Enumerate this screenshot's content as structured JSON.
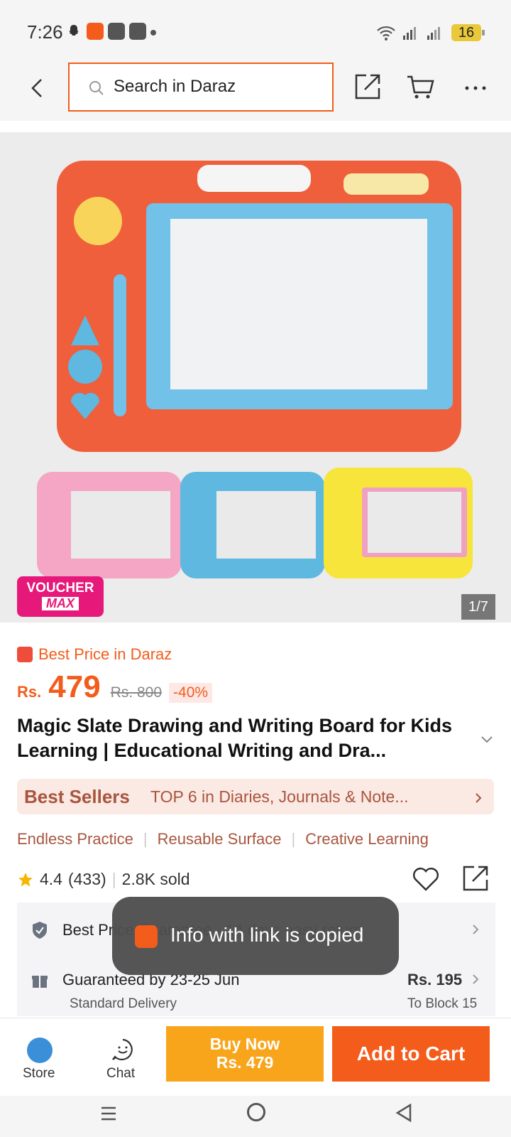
{
  "status_bar": {
    "time": "7:26",
    "battery": "16"
  },
  "header": {
    "search_placeholder": "Search in Daraz"
  },
  "gallery": {
    "voucher_line1": "VOUCHER",
    "voucher_line2": "MAX",
    "counter": "1/7"
  },
  "product": {
    "best_price_label": "Best Price in Daraz",
    "currency": "Rs.",
    "price": "479",
    "original_price": "Rs. 800",
    "discount": "-40%",
    "title": "Magic Slate Drawing and Writing Board for Kids Learning | Educational Writing and Dra...",
    "best_sellers_label": "Best Sellers",
    "best_sellers_text": "TOP 6 in Diaries, Journals & Note...",
    "features": [
      "Endless Practice",
      "Reusable Surface",
      "Creative Learning"
    ],
    "rating": "4.4",
    "reviews": "(433)",
    "sold": "2.8K sold"
  },
  "delivery": {
    "guarantee_text": "Best Price Guarantee · 14 days easy return",
    "date": "Guaranteed by 23-25 Jun",
    "price": "Rs. 195",
    "type": "Standard Delivery",
    "location": "To Block 15"
  },
  "toast": {
    "text": "Info with link is copied"
  },
  "bottom_bar": {
    "store": "Store",
    "chat": "Chat",
    "buy_now_line1": "Buy Now",
    "buy_now_line2": "Rs. 479",
    "add_to_cart": "Add to Cart"
  },
  "colors": {
    "accent": "#f35c1b",
    "buy_now": "#f9a51b",
    "voucher": "#e6197a"
  }
}
